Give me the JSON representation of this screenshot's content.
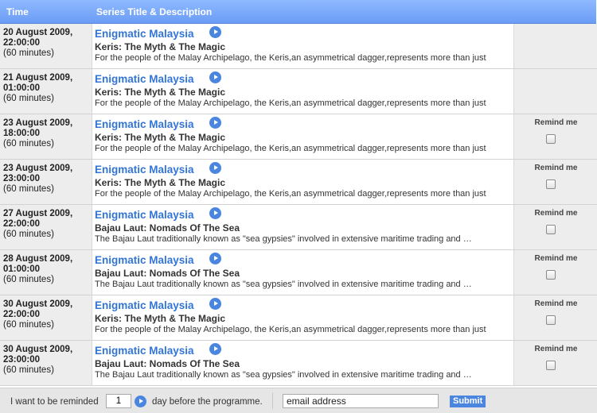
{
  "header": {
    "time_label": "Time",
    "title_label": "Series Title & Description"
  },
  "rows": [
    {
      "date": "20 August 2009,",
      "time": "22:00:00",
      "duration": "(60 minutes)",
      "series": "Enigmatic Malaysia",
      "episode": "Keris: The Myth & The Magic",
      "synopsis": "For the people of the Malay Archipelago, the Keris,an asymmetrical dagger,represents more than just",
      "remind_label": "",
      "has_remind": false
    },
    {
      "date": "21 August 2009,",
      "time": "01:00:00",
      "duration": "(60 minutes)",
      "series": "Enigmatic Malaysia",
      "episode": "Keris: The Myth & The Magic",
      "synopsis": "For the people of the Malay Archipelago, the Keris,an asymmetrical dagger,represents more than just",
      "remind_label": "",
      "has_remind": false
    },
    {
      "date": "23 August 2009,",
      "time": "18:00:00",
      "duration": "(60 minutes)",
      "series": "Enigmatic Malaysia",
      "episode": "Keris: The Myth & The Magic",
      "synopsis": "For the people of the Malay Archipelago, the Keris,an asymmetrical dagger,represents more than just",
      "remind_label": "Remind me",
      "has_remind": true
    },
    {
      "date": "23 August 2009,",
      "time": "23:00:00",
      "duration": "(60 minutes)",
      "series": "Enigmatic Malaysia",
      "episode": "Keris: The Myth & The Magic",
      "synopsis": "For the people of the Malay Archipelago, the Keris,an asymmetrical dagger,represents more than just",
      "remind_label": "Remind me",
      "has_remind": true
    },
    {
      "date": "27 August 2009,",
      "time": "22:00:00",
      "duration": "(60 minutes)",
      "series": "Enigmatic Malaysia",
      "episode": "Bajau Laut: Nomads Of The Sea",
      "synopsis": "The Bajau Laut traditionally known as \"sea gypsies\" involved in extensive maritime trading and …",
      "remind_label": "Remind me",
      "has_remind": true
    },
    {
      "date": "28 August 2009,",
      "time": "01:00:00",
      "duration": "(60 minutes)",
      "series": "Enigmatic Malaysia",
      "episode": "Bajau Laut: Nomads Of The Sea",
      "synopsis": "The Bajau Laut traditionally known as \"sea gypsies\" involved in extensive maritime trading and …",
      "remind_label": "Remind me",
      "has_remind": true
    },
    {
      "date": "30 August 2009,",
      "time": "22:00:00",
      "duration": "(60 minutes)",
      "series": "Enigmatic Malaysia",
      "episode": "Keris: The Myth & The Magic",
      "synopsis": "For the people of the Malay Archipelago, the Keris,an asymmetrical dagger,represents more than just",
      "remind_label": "Remind me",
      "has_remind": true
    },
    {
      "date": "30 August 2009,",
      "time": "23:00:00",
      "duration": "(60 minutes)",
      "series": "Enigmatic Malaysia",
      "episode": "Bajau Laut: Nomads Of The Sea",
      "synopsis": "The Bajau Laut traditionally known as \"sea gypsies\" involved in extensive maritime trading and …",
      "remind_label": "Remind me",
      "has_remind": true
    }
  ],
  "footer": {
    "prefix": "I want to be reminded",
    "days_value": "1",
    "suffix": "day before the programme.",
    "email_placeholder": "email address",
    "submit_label": "Submit"
  },
  "icons": {
    "play": "play-circle-icon",
    "checkbox": "checkbox-icon"
  },
  "colors": {
    "header_bg": "#7aa8fa",
    "link": "#3275d6",
    "button": "#4a86e0"
  }
}
